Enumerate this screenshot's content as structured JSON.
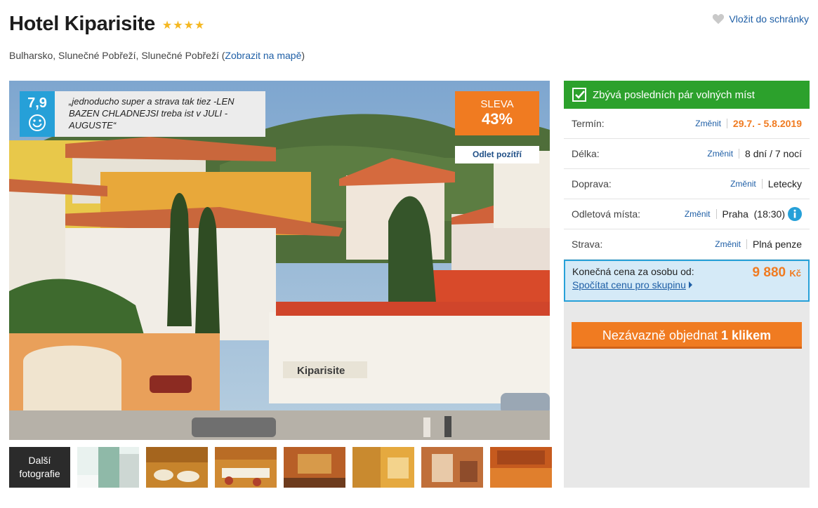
{
  "hotel": {
    "name": "Hotel Kiparisite",
    "stars": [
      "★",
      "★",
      "★",
      "★"
    ],
    "location_text": "Bulharsko, Slunečné Pobřeží, Slunečné Pobřeží (",
    "map_link": "Zobrazit na mapě",
    "location_close": ")"
  },
  "favorite": {
    "label": "Vložit do schránky",
    "icon": "heart-icon"
  },
  "photo": {
    "rating": "7,9",
    "review": "„jednoducho super a strava tak tiez -LEN BAZEN CHLADNEJSI treba ist v JULI - AUGUSTE“",
    "discount_label": "SLEVA",
    "discount_value": "43%",
    "depart_button": "Odlet pozítří",
    "sign_text": "Kiparisite"
  },
  "gallery": {
    "more_label_line1": "Další",
    "more_label_line2": "fotografie",
    "thumb_count": 7
  },
  "booking": {
    "availability": "Zbývá posledních pár volných míst",
    "rows": [
      {
        "label": "Termín:",
        "change": "Změnit",
        "value": "29.7. - 5.8.2019"
      },
      {
        "label": "Délka:",
        "change": "Změnit",
        "value": "8 dní / 7 nocí"
      },
      {
        "label": "Doprava:",
        "change": "Změnit",
        "value": "Letecky"
      },
      {
        "label": "Odletová místa:",
        "change": "Změnit",
        "value": "Praha  (18:30)"
      },
      {
        "label": "Strava:",
        "change": "Změnit",
        "value": "Plná penze"
      }
    ],
    "price_label": "Konečná cena za osobu od:",
    "price_value": "9 880",
    "price_currency": "Kč",
    "group_link": "Spočítat cenu pro skupinu",
    "order_text": "Nezávazně objednat",
    "order_bold": "1 klikem"
  },
  "colors": {
    "accent_orange": "#f07b21",
    "link_blue": "#1f5fa6",
    "green": "#2ca12c",
    "rating_blue": "#26a0d8"
  }
}
